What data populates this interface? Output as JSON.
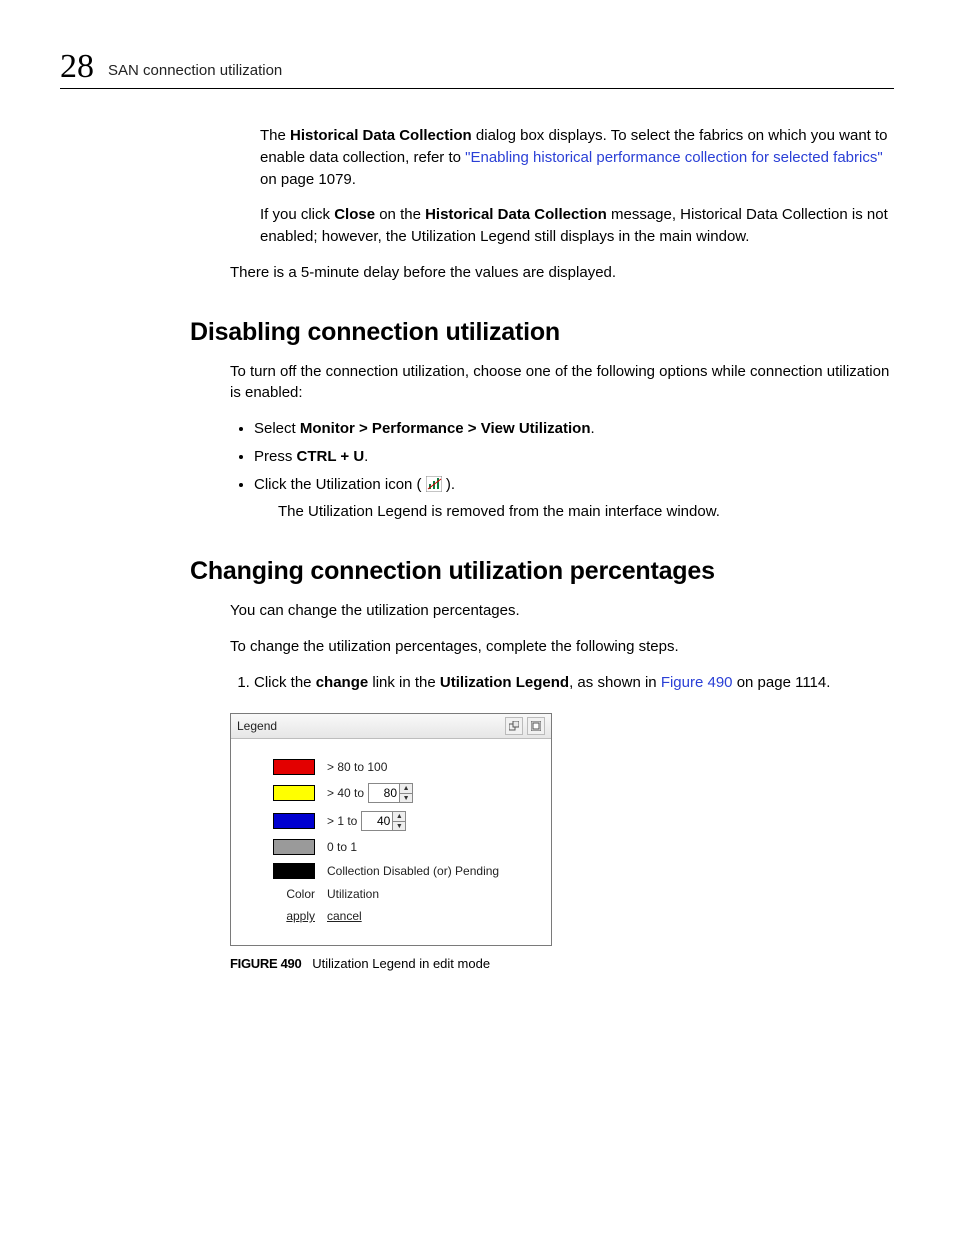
{
  "header": {
    "chapter_number": "28",
    "section_title": "SAN connection utilization"
  },
  "intro": {
    "p1_a": "The ",
    "p1_b": "Historical Data Collection",
    "p1_c": " dialog box displays. To select the fabrics on which you want to enable data collection, refer to ",
    "p1_link": "\"Enabling historical performance collection for selected fabrics\"",
    "p1_d": " on page 1079.",
    "p2_a": "If you click ",
    "p2_b": "Close",
    "p2_c": " on the ",
    "p2_d": "Historical Data Collection",
    "p2_e": " message, Historical Data Collection is not enabled; however, the Utilization Legend still displays in the main window.",
    "p3": "There is a 5-minute delay before the values are displayed."
  },
  "disabling": {
    "heading": "Disabling connection utilization",
    "intro": "To turn off the connection utilization, choose one of the following options while connection utilization is enabled:",
    "b1_a": "Select ",
    "b1_b": "Monitor > Performance > View Utilization",
    "b1_c": ".",
    "b2_a": "Press ",
    "b2_b": "CTRL + U",
    "b2_c": ".",
    "b3_a": "Click the Utilization icon (",
    "b3_b": ").",
    "after": "The Utilization Legend is removed from the main interface window."
  },
  "changing": {
    "heading": "Changing connection utilization percentages",
    "p1": "You can change the utilization percentages.",
    "p2": "To change the utilization percentages, complete the following steps.",
    "s1_a": "Click the ",
    "s1_b": "change",
    "s1_c": " link in the ",
    "s1_d": "Utilization Legend",
    "s1_e": ", as shown in ",
    "s1_link": "Figure 490",
    "s1_f": " on page 1114."
  },
  "legend": {
    "title": "Legend",
    "rows": [
      {
        "color": "#e30000",
        "label_a": "> 80 to 100",
        "spinner": null
      },
      {
        "color": "#ffff00",
        "label_a": "> 40 to",
        "spinner": "80"
      },
      {
        "color": "#0000d0",
        "label_a": "> 1 to",
        "spinner": "40"
      },
      {
        "color": "#9a9a9a",
        "label_a": "0 to 1",
        "spinner": null
      },
      {
        "color": "#000000",
        "label_a": "Collection Disabled (or) Pending",
        "spinner": null
      }
    ],
    "footer_left": "Color",
    "footer_right": "Utilization",
    "apply": "apply",
    "cancel": "cancel"
  },
  "figure": {
    "label": "FIGURE 490",
    "caption": "Utilization Legend in edit mode"
  }
}
